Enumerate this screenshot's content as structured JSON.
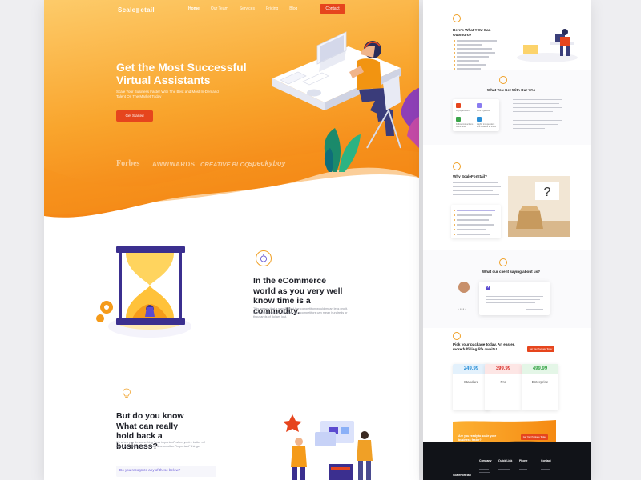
{
  "brand": {
    "logo_left": "Scale",
    "logo_right": "etail"
  },
  "nav": {
    "links": [
      "Home",
      "Our Team",
      "Services",
      "Pricing",
      "Blog"
    ],
    "contact_label": "Contact"
  },
  "hero": {
    "title": "Get the Most Successful Virtual Assistants",
    "subtitle": "Scale Your Business Faster With The Best and Most In-Demand Talent On The Market Today",
    "cta_label": "Get Started",
    "press": [
      "Forbes",
      "AWWWARDS",
      "CREATIVE BLOQ",
      "speckyboy"
    ]
  },
  "section_time": {
    "title": "In the eCommerce world as you very well know time is a commodity.",
    "body": "This means that a step Behind the competition would mean less profit. Being three minutes late than your competitors can mean hundreds or thousands of dollars lost."
  },
  "section_hold": {
    "title": "But do you know What can really hold back a business?",
    "body": "It's when you do something \"less important\" when you're better off doing spending your precious time on other \"important\" things.",
    "question": "Do you recognize any of these below?"
  },
  "right_page": {
    "outsource_title": "Here's What YOU Can Outsource",
    "vas_title": "What You Get With Our VAs",
    "va_items": [
      "Highly efficient",
      "Well organized",
      "Follow instructions to the letter",
      "Highly independent and detailed at times"
    ],
    "why_title": "Why ScaleForEtail?",
    "client_title": "What our client saying about us?",
    "package_title": "Pick your package today. An easier, more fulfilling life awaits!",
    "package_btn": "Get Your Package Today",
    "prices": [
      {
        "amount": "249.99",
        "name": "Standard",
        "color": "#2a8fd6",
        "bg": "#e3f1fc"
      },
      {
        "amount": "399.99",
        "name": "Pro",
        "color": "#d9302a",
        "bg": "#fde6e5"
      },
      {
        "amount": "499.99",
        "name": "Enterprise",
        "color": "#3aa54a",
        "bg": "#e4f6e7"
      }
    ],
    "cta_banner": "Are you ready to scale your business faster?",
    "cta_banner_btn": "Get Your Package Today",
    "footer_cols": [
      "Company",
      "Quick Link",
      "Phone",
      "Contact"
    ],
    "footer_logo": "ScaleForEtail"
  },
  "colors": {
    "hero_top": "#fdc35a",
    "hero_bottom": "#f58a12",
    "accent": "#e6451d",
    "amber": "#f0a026",
    "purple": "#5b4bd0"
  }
}
